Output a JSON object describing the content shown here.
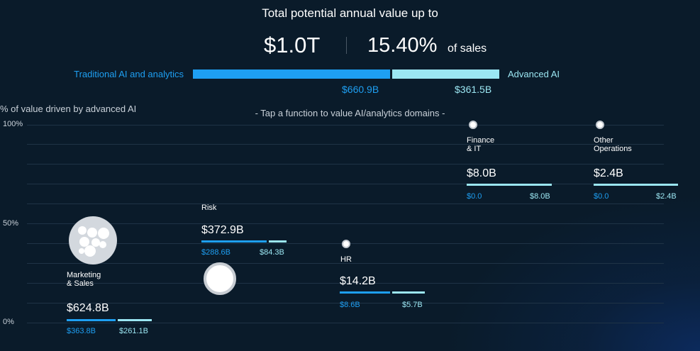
{
  "header": {
    "title": "Total potential annual value up to",
    "total_value": "$1.0T",
    "percent_value": "15.40%",
    "percent_suffix": "of sales"
  },
  "summary": {
    "traditional_label": "Traditional AI and analytics",
    "advanced_label": "Advanced AI",
    "traditional_value": "$660.9B",
    "advanced_value": "$361.5B"
  },
  "chart_header": {
    "y_title": "% of value driven by advanced AI",
    "hint": "- Tap a function to value AI/analytics domains -"
  },
  "colors": {
    "traditional": "#1e9ff2",
    "advanced": "#9be6f2",
    "background": "#0a1b2a"
  },
  "icons": [
    "circle-dot-icon",
    "bubble-cluster-icon",
    "ring-icon"
  ],
  "chart_data": {
    "type": "scatter",
    "y_title": "% of value driven by advanced AI",
    "y_ticks": [
      "100%",
      "50%",
      "0%"
    ],
    "ylim": [
      0,
      100
    ],
    "grid": true,
    "functions": [
      {
        "name": "Marketing\n& Sales",
        "total": "$624.8B",
        "traditional": "$363.8B",
        "advanced": "$261.1B",
        "traditional_value": 363.8,
        "advanced_value": 261.1,
        "advanced_share_pct": 42
      },
      {
        "name": "Risk",
        "total": "$372.9B",
        "traditional": "$288.6B",
        "advanced": "$84.3B",
        "traditional_value": 288.6,
        "advanced_value": 84.3,
        "advanced_share_pct": 23
      },
      {
        "name": "HR",
        "total": "$14.2B",
        "traditional": "$8.6B",
        "advanced": "$5.7B",
        "traditional_value": 8.6,
        "advanced_value": 5.7,
        "advanced_share_pct": 40
      },
      {
        "name": "Finance\n& IT",
        "total": "$8.0B",
        "traditional": "$0.0",
        "advanced": "$8.0B",
        "traditional_value": 0.0,
        "advanced_value": 8.0,
        "advanced_share_pct": 100
      },
      {
        "name": "Other\nOperations",
        "total": "$2.4B",
        "traditional": "$0.0",
        "advanced": "$2.4B",
        "traditional_value": 0.0,
        "advanced_value": 2.4,
        "advanced_share_pct": 100
      }
    ]
  }
}
